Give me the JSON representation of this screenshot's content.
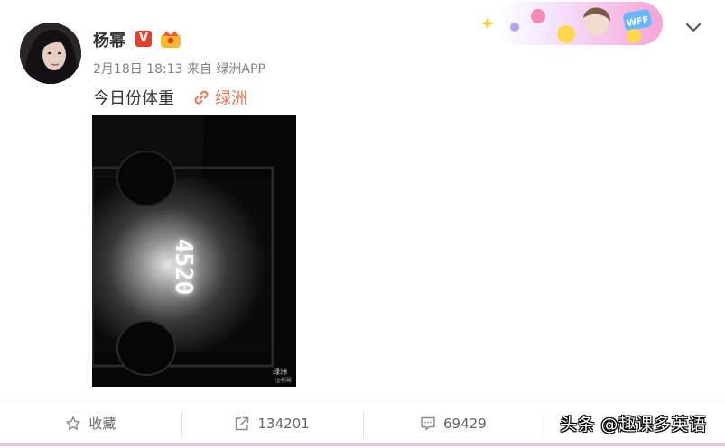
{
  "post": {
    "username": "杨幂",
    "verified_badge": "V",
    "verified_icon": "verified-v-icon",
    "member_icon": "crown-icon",
    "date": "2月18日 18:13",
    "source_prefix": "来自",
    "source": "绿洲APP",
    "text": "今日份体重",
    "link_icon": "link-icon",
    "link_label": "绿洲",
    "image": {
      "scale_reading": "4520",
      "watermark_app": "绿洲",
      "watermark_user": "@杨幂"
    }
  },
  "header": {
    "banner_badge": "WFF",
    "more_icon": "chevron-down-icon"
  },
  "actions": [
    {
      "icon": "star-icon",
      "label": "收藏"
    },
    {
      "icon": "share-icon",
      "label": "134201"
    },
    {
      "icon": "comment-icon",
      "label": "69429"
    }
  ],
  "watermark": "头条 @趣课多英语",
  "colors": {
    "accent": "#eb7350",
    "verified": "#e4412b",
    "text": "#333333",
    "meta": "#808080"
  }
}
